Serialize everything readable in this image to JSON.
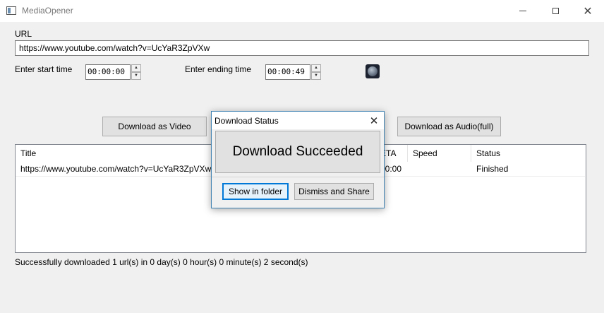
{
  "window": {
    "title": "MediaOpener"
  },
  "url_section": {
    "label": "URL",
    "value": "https://www.youtube.com/watch?v=UcYaR3ZpVXw"
  },
  "start_time": {
    "label": "Enter start time",
    "value": "00:00:00"
  },
  "end_time": {
    "label": "Enter ending time",
    "value": "00:00:49"
  },
  "buttons": {
    "download_video": "Download as Video",
    "download_audio": "Download as Audio(full)"
  },
  "table": {
    "columns": [
      "Title",
      "ETA",
      "Speed",
      "Status"
    ],
    "rows": [
      {
        "title": "https://www.youtube.com/watch?v=UcYaR3ZpVXw",
        "eta": "00:00",
        "speed": "",
        "status": "Finished"
      }
    ]
  },
  "status_text": "Successfully downloaded 1 url(s) in 0 day(s) 0 hour(s) 0 minute(s) 2 second(s)",
  "dialog": {
    "title": "Download Status",
    "message": "Download Succeeded",
    "show_in_folder": "Show in folder",
    "dismiss_share": "Dismiss and Share"
  }
}
